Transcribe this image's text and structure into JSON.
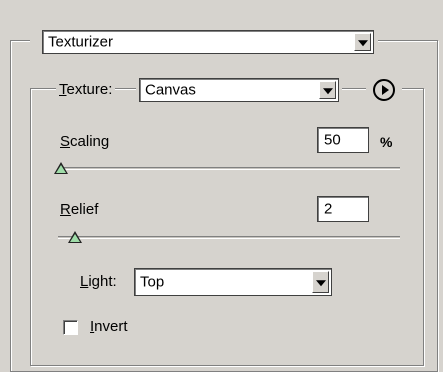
{
  "filter": {
    "selected": "Texturizer"
  },
  "texture": {
    "label_mn": "T",
    "label_rest": "exture:",
    "selected": "Canvas"
  },
  "scaling": {
    "label_mn": "S",
    "label_rest": "caling",
    "value": "50",
    "unit": "%",
    "slider_fraction": 0.0
  },
  "relief": {
    "label_mn": "R",
    "label_rest": "elief",
    "value": "2",
    "slider_fraction": 0.04
  },
  "light": {
    "label_pre": "",
    "label_mn": "L",
    "label_rest": "ight:",
    "selected": "Top"
  },
  "invert": {
    "label_mn": "I",
    "label_rest": "nvert",
    "checked": false
  },
  "icons": {
    "texture_menu": "play-circle-icon",
    "dropdown_arrow": "chevron-down-icon"
  }
}
